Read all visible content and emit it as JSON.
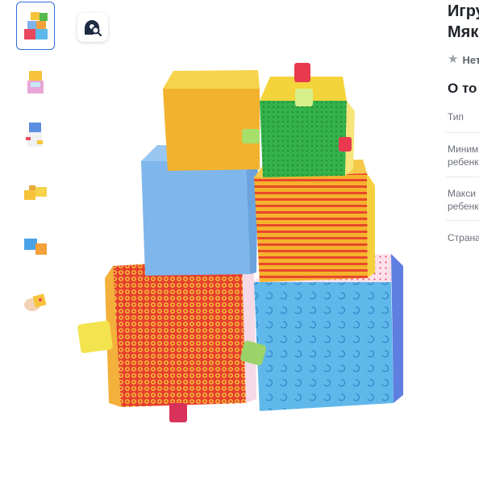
{
  "product": {
    "title_lines": [
      "Игру",
      "Мяк"
    ],
    "rating_text": "Нет",
    "about_title": "О то",
    "specs": [
      {
        "label_lines": [
          "Тип"
        ]
      },
      {
        "label_lines": [
          "Миним",
          "ребенк"
        ]
      },
      {
        "label_lines": [
          "Макси",
          "ребенк"
        ]
      },
      {
        "label_lines": [
          "Страна"
        ]
      }
    ]
  },
  "gallery": {
    "thumbnail_count": 6,
    "selected_index": 0,
    "zoom_icon": "search-icon"
  },
  "colors": {
    "accent": "#2f6ee2",
    "text": "#1f2329",
    "muted": "#6b7079"
  }
}
